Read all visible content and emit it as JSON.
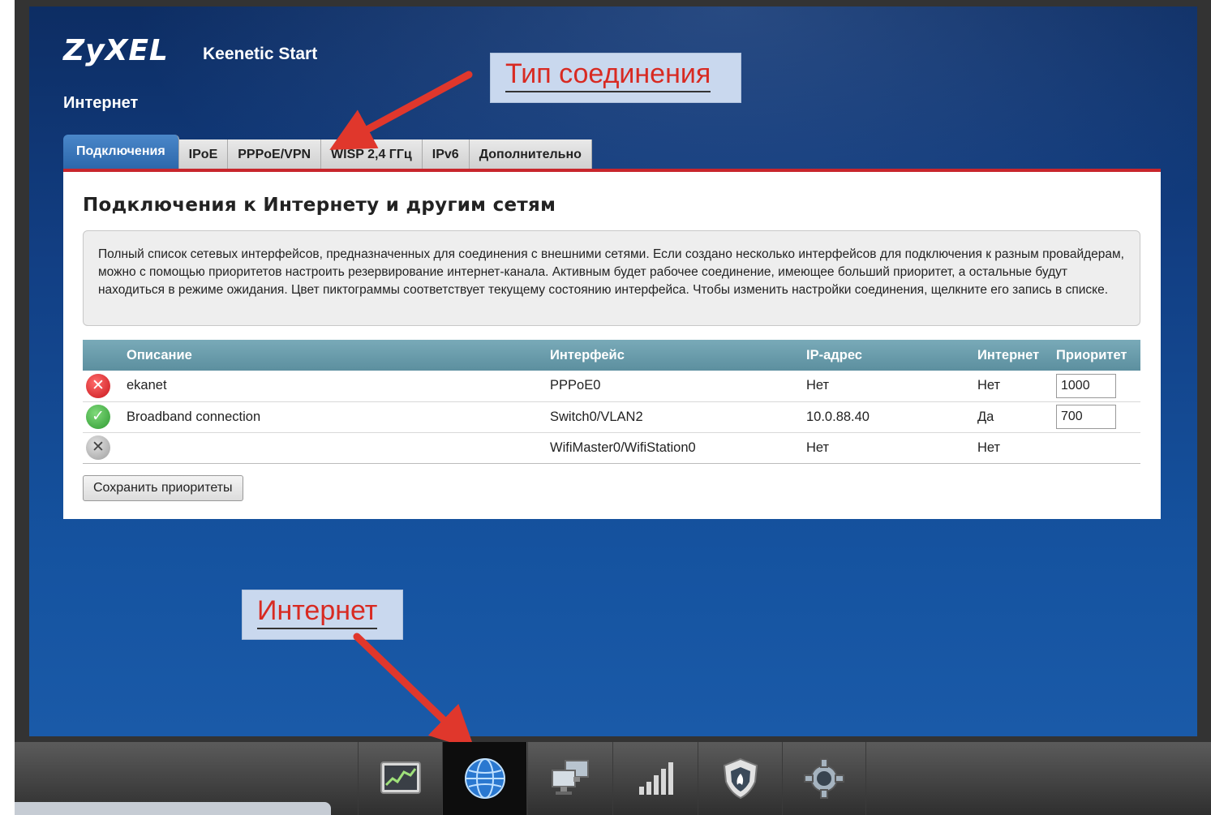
{
  "header": {
    "logo": "ZyXEL",
    "model": "Keenetic Start",
    "section": "Интернет"
  },
  "tabs": [
    {
      "label": "Подключения",
      "active": true
    },
    {
      "label": "IPoE"
    },
    {
      "label": "PPPoE/VPN"
    },
    {
      "label": "WISP 2,4 ГГц"
    },
    {
      "label": "IPv6"
    },
    {
      "label": "Дополнительно"
    }
  ],
  "panel": {
    "title": "Подключения к Интернету и другим сетям",
    "info": "Полный список сетевых интерфейсов, предназначенных для соединения с внешними сетями. Если создано несколько интерфейсов для подключения к разным провайдерам, можно с помощью приоритетов настроить резервирование интернет-канала. Активным будет рабочее соединение, имеющее больший приоритет, а остальные будут находиться в режиме ожидания. Цвет пиктограммы соответствует текущему состоянию интерфейса. Чтобы изменить настройки соединения, щелкните его запись в списке."
  },
  "table": {
    "columns": [
      "Описание",
      "Интерфейс",
      "IP-адрес",
      "Интернет",
      "Приоритет"
    ],
    "rows": [
      {
        "status": "error",
        "description": "ekanet",
        "interface": "PPPoE0",
        "ip": "Нет",
        "internet": "Нет",
        "priority": "1000"
      },
      {
        "status": "ok",
        "description": "Broadband connection",
        "interface": "Switch0/VLAN2",
        "ip": "10.0.88.40",
        "internet": "Да",
        "priority": "700"
      },
      {
        "status": "disabled",
        "description": "",
        "interface": "WifiMaster0/WifiStation0",
        "ip": "Нет",
        "internet": "Нет",
        "priority": ""
      }
    ]
  },
  "buttons": {
    "save_priorities": "Сохранить приоритеты"
  },
  "annotations": {
    "connection_type": "Тип соединения",
    "internet": "Интернет"
  },
  "dock": [
    {
      "icon": "chart-icon"
    },
    {
      "icon": "globe-icon",
      "active": true
    },
    {
      "icon": "network-computers-icon"
    },
    {
      "icon": "signal-bars-icon"
    },
    {
      "icon": "firewall-shield-icon"
    },
    {
      "icon": "gear-icon"
    }
  ],
  "colors": {
    "accent_red": "#c8262c",
    "tab_active": "#2b66aa",
    "table_header": "#5c8f9f",
    "annotation_text": "#d82a22"
  }
}
